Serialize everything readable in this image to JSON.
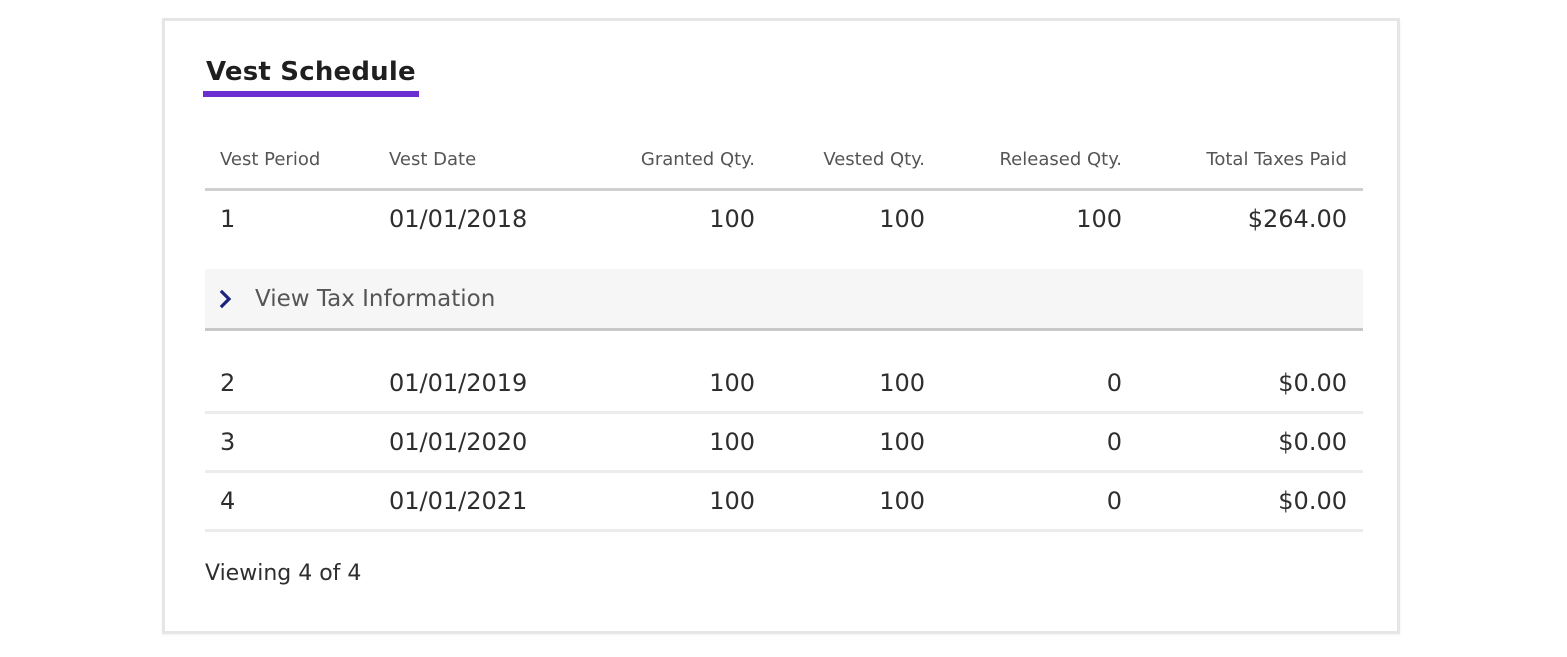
{
  "card": {
    "title": "Vest Schedule"
  },
  "table": {
    "columns": [
      "Vest Period",
      "Vest Date",
      "Granted Qty.",
      "Vested Qty.",
      "Released Qty.",
      "Total Taxes Paid"
    ],
    "rows": [
      [
        "1",
        "01/01/2018",
        "100",
        "100",
        "100",
        "$264.00"
      ],
      [
        "2",
        "01/01/2019",
        "100",
        "100",
        "0",
        "$0.00"
      ],
      [
        "3",
        "01/01/2020",
        "100",
        "100",
        "0",
        "$0.00"
      ],
      [
        "4",
        "01/01/2021",
        "100",
        "100",
        "0",
        "$0.00"
      ]
    ],
    "expander_label": "View Tax Information",
    "expander_icon": "chevron-right-icon"
  },
  "footer": {
    "viewing_text": "Viewing 4 of 4"
  },
  "colors": {
    "accent": "#6b2fd1",
    "chevron": "#1a237e"
  }
}
